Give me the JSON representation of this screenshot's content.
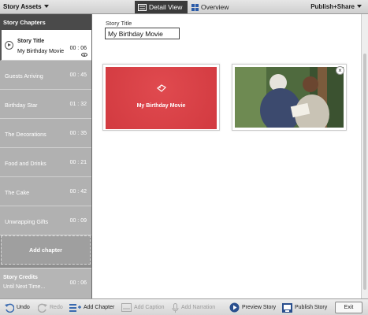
{
  "header": {
    "story_assets": "Story Assets",
    "tab_detail": "Detail View",
    "tab_overview": "Overview",
    "publish_share": "Publish+Share"
  },
  "sidebar": {
    "heading": "Story Chapters",
    "selected": {
      "title": "Story Title",
      "subtitle": "My Birthday Movie",
      "duration": "00 : 06"
    },
    "chapters": [
      {
        "label": "Guests Arriving",
        "duration": "00 : 45"
      },
      {
        "label": "Birthday Star",
        "duration": "01 : 32"
      },
      {
        "label": "The Decorations",
        "duration": "00 : 35"
      },
      {
        "label": "Food and Drinks",
        "duration": "00 : 21"
      },
      {
        "label": "The Cake",
        "duration": "00 : 42"
      },
      {
        "label": "Unwrapping Gifts",
        "duration": "00 : 09"
      }
    ],
    "add_chapter": "Add chapter",
    "credits": {
      "title": "Story Credits",
      "subtitle": "Until Next Time...",
      "duration": "00 : 06"
    }
  },
  "main": {
    "story_title_label": "Story Title",
    "story_title_value": "My Birthday Movie",
    "slide_text": "My Birthday Movie"
  },
  "toolbar": {
    "undo": "Undo",
    "redo": "Redo",
    "add_chapter": "Add Chapter",
    "add_caption": "Add Caption",
    "add_narration": "Add Narration",
    "preview_story": "Preview Story",
    "publish_story": "Publish Story",
    "exit": "Exit"
  },
  "colors": {
    "accent_red": "#d23a40",
    "dark_tab": "#3b3b3b",
    "sidebar_gray": "#b1b1b1"
  }
}
